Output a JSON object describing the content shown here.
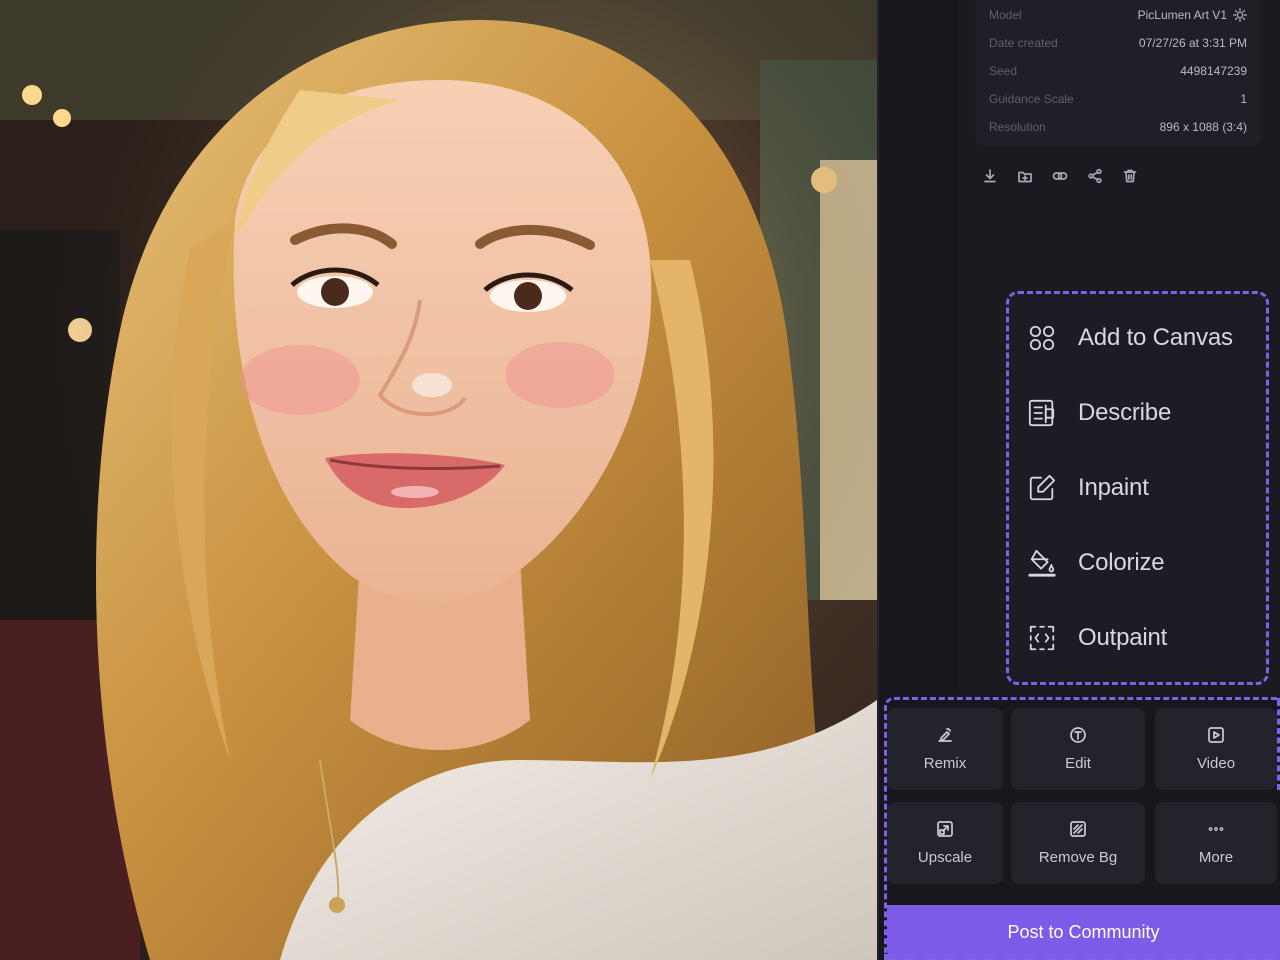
{
  "details": {
    "rows": [
      {
        "label": "Model",
        "value": "PicLumen Art V1"
      },
      {
        "label": "Date created",
        "value": "07/27/26 at 3:31 PM"
      },
      {
        "label": "Seed",
        "value": "4498147239"
      },
      {
        "label": "Guidance Scale",
        "value": "1"
      },
      {
        "label": "Resolution",
        "value": "896 x 1088 (3:4)"
      }
    ]
  },
  "quick_actions": [
    "download-icon",
    "folder-add-icon",
    "link-icon",
    "share-icon",
    "trash-icon"
  ],
  "menu": {
    "items": [
      {
        "label": "Add to Canvas",
        "icon": "canvas-icon"
      },
      {
        "label": "Describe",
        "icon": "describe-icon"
      },
      {
        "label": "Inpaint",
        "icon": "inpaint-icon"
      },
      {
        "label": "Colorize",
        "icon": "colorize-icon"
      },
      {
        "label": "Outpaint",
        "icon": "outpaint-icon"
      }
    ]
  },
  "tools": [
    {
      "label": "Remix",
      "icon": "remix-icon"
    },
    {
      "label": "Edit",
      "icon": "edit-icon"
    },
    {
      "label": "Video",
      "icon": "video-icon"
    },
    {
      "label": "Upscale",
      "icon": "upscale-icon"
    },
    {
      "label": "Remove Bg",
      "icon": "remove-bg-icon"
    },
    {
      "label": "More",
      "icon": "more-icon"
    }
  ],
  "post_button": "Post to Community",
  "colors": {
    "accent": "#7b5be8",
    "panel": "#17171d"
  }
}
